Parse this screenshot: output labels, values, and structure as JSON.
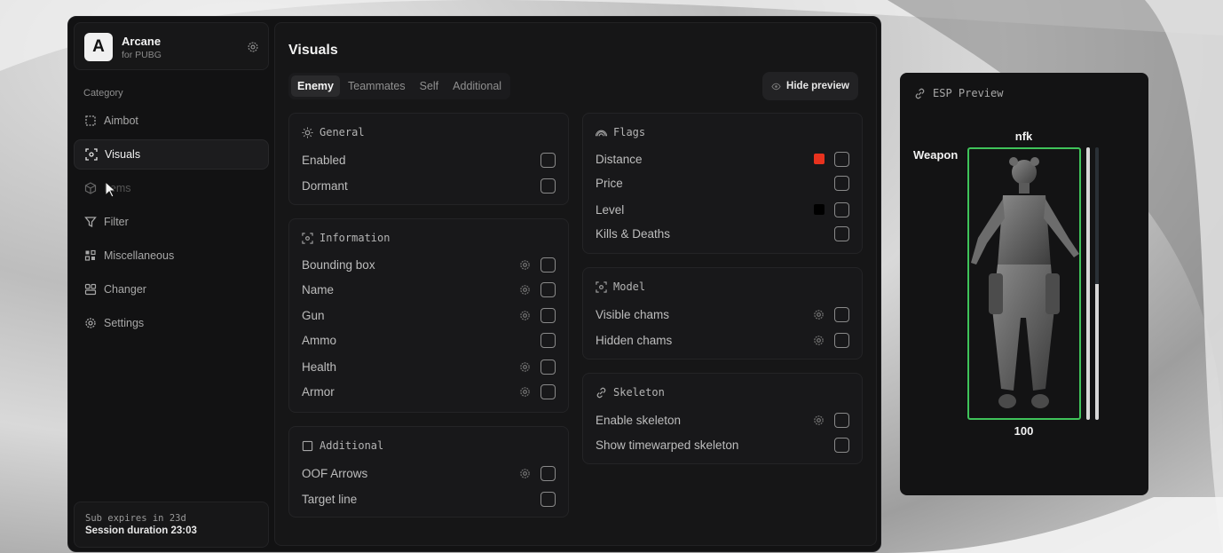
{
  "app": {
    "name": "Arcane",
    "subtitle": "for PUBG",
    "logo_letter": "A"
  },
  "sidebar": {
    "category_label": "Category",
    "items": [
      {
        "label": "Aimbot",
        "icon": "crosshair-icon",
        "state": "normal"
      },
      {
        "label": "Visuals",
        "icon": "scan-icon",
        "state": "active"
      },
      {
        "label": "Items",
        "icon": "cube-icon",
        "state": "muted"
      },
      {
        "label": "Filter",
        "icon": "funnel-icon",
        "state": "normal"
      },
      {
        "label": "Miscellaneous",
        "icon": "grid-icon",
        "state": "normal"
      },
      {
        "label": "Changer",
        "icon": "layout-icon",
        "state": "normal"
      },
      {
        "label": "Settings",
        "icon": "gear-icon",
        "state": "normal"
      }
    ],
    "sub_expires": "Sub expires in 23d",
    "session_duration": "Session duration 23:03"
  },
  "main": {
    "title": "Visuals",
    "tabs": [
      {
        "label": "Enemy",
        "active": true
      },
      {
        "label": "Teammates",
        "active": false
      },
      {
        "label": "Self",
        "active": false
      },
      {
        "label": "Additional",
        "active": false
      }
    ],
    "hide_preview_label": "Hide preview",
    "general": {
      "title": "General",
      "rows": [
        {
          "label": "Enabled",
          "gear": false
        },
        {
          "label": "Dormant",
          "gear": false
        }
      ]
    },
    "information": {
      "title": "Information",
      "rows": [
        {
          "label": "Bounding box",
          "gear": true
        },
        {
          "label": "Name",
          "gear": true
        },
        {
          "label": "Gun",
          "gear": true
        },
        {
          "label": "Ammo",
          "gear": false
        },
        {
          "label": "Health",
          "gear": true
        },
        {
          "label": "Armor",
          "gear": true
        }
      ]
    },
    "additional": {
      "title": "Additional",
      "rows": [
        {
          "label": "OOF Arrows",
          "gear": true
        },
        {
          "label": "Target line",
          "gear": false
        }
      ]
    },
    "flags": {
      "title": "Flags",
      "rows": [
        {
          "label": "Distance",
          "color": "#e8321e"
        },
        {
          "label": "Price",
          "color": null
        },
        {
          "label": "Level",
          "color": "#000000"
        },
        {
          "label": "Kills & Deaths",
          "color": null
        }
      ]
    },
    "model": {
      "title": "Model",
      "rows": [
        {
          "label": "Visible chams",
          "gear": true
        },
        {
          "label": "Hidden chams",
          "gear": true
        }
      ]
    },
    "skeleton": {
      "title": "Skeleton",
      "rows": [
        {
          "label": "Enable skeleton",
          "gear": true
        },
        {
          "label": "Show timewarped skeleton",
          "gear": false
        }
      ]
    }
  },
  "preview": {
    "title": "ESP Preview",
    "player_name": "nfk",
    "weapon_label": "Weapon",
    "health_value": "100",
    "box_color": "#3fc35a",
    "health_bar_fraction": 1.0,
    "armor_bar_fraction": 0.5
  }
}
